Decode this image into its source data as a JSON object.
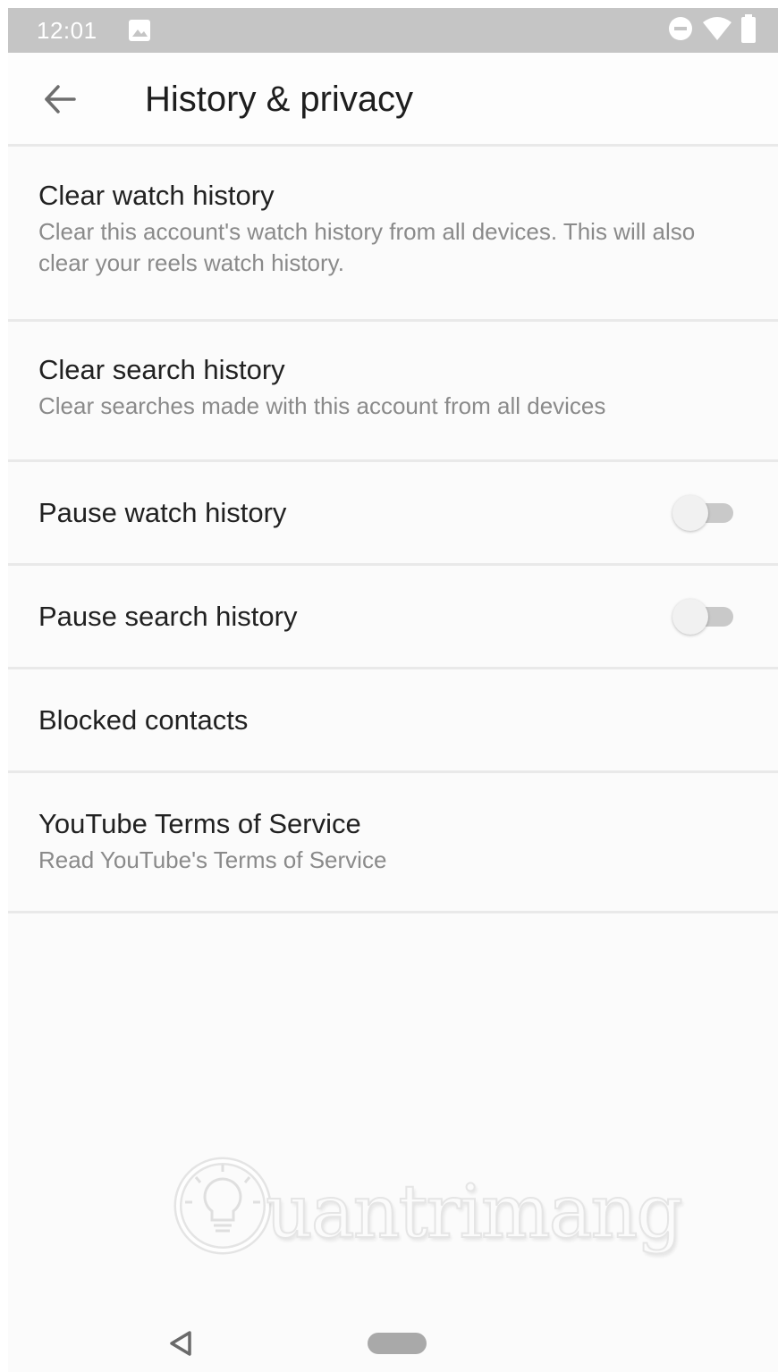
{
  "status_bar": {
    "time": "12:01",
    "icons": [
      "image-icon",
      "do-not-disturb-icon",
      "wifi-icon",
      "battery-icon"
    ]
  },
  "app_bar": {
    "title": "History & privacy",
    "back_icon": "arrow-back-icon"
  },
  "settings": [
    {
      "title": "Clear watch history",
      "subtitle": "Clear this account's watch history from all devices. This will also clear your reels watch history."
    },
    {
      "title": "Clear search history",
      "subtitle": "Clear searches made with this account from all devices"
    },
    {
      "title": "Pause watch history",
      "toggle": false
    },
    {
      "title": "Pause search history",
      "toggle": false
    },
    {
      "title": "Blocked contacts"
    },
    {
      "title": "YouTube Terms of Service",
      "subtitle": "Read YouTube's Terms of Service"
    }
  ],
  "watermark": {
    "text": "uantrimang"
  },
  "nav_bar": {
    "icons": [
      "nav-back-icon",
      "nav-home-pill"
    ]
  },
  "colors": {
    "status_bar": "#c5c5c5",
    "background": "#fbfbfb",
    "title_text": "#212121",
    "subtitle_text": "#8a8a8a",
    "divider": "#e9e9e9",
    "toggle_track": "#c9c9c9",
    "toggle_thumb": "#f1f1f1"
  }
}
